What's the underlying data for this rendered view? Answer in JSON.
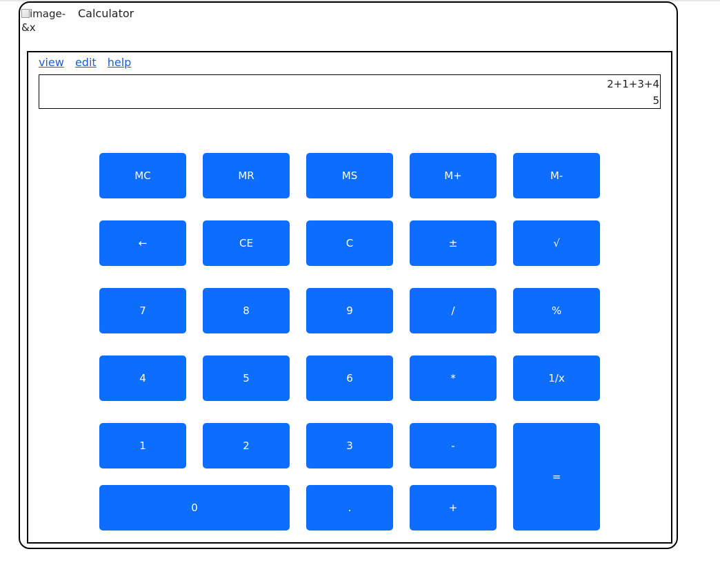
{
  "window": {
    "image_alt": "image-&x",
    "title": "Calculator"
  },
  "menu": {
    "view": "view",
    "edit": "edit",
    "help": "help"
  },
  "display": {
    "expression": "2+1+3+4",
    "result": "5"
  },
  "buttons": {
    "mc": "MC",
    "mr": "MR",
    "ms": "MS",
    "m_plus": "M+",
    "m_minus": "M-",
    "backspace": "←",
    "ce": "CE",
    "c": "C",
    "plus_minus": "±",
    "sqrt": "√",
    "seven": "7",
    "eight": "8",
    "nine": "9",
    "divide": "/",
    "percent": "%",
    "four": "4",
    "five": "5",
    "six": "6",
    "multiply": "*",
    "reciprocal": "1/x",
    "one": "1",
    "two": "2",
    "three": "3",
    "minus": "-",
    "equals": "=",
    "zero": "0",
    "decimal": ".",
    "plus": "+"
  },
  "colors": {
    "button_bg": "#0d6efd",
    "button_text": "#ffffff",
    "link": "#1a5fd8"
  }
}
